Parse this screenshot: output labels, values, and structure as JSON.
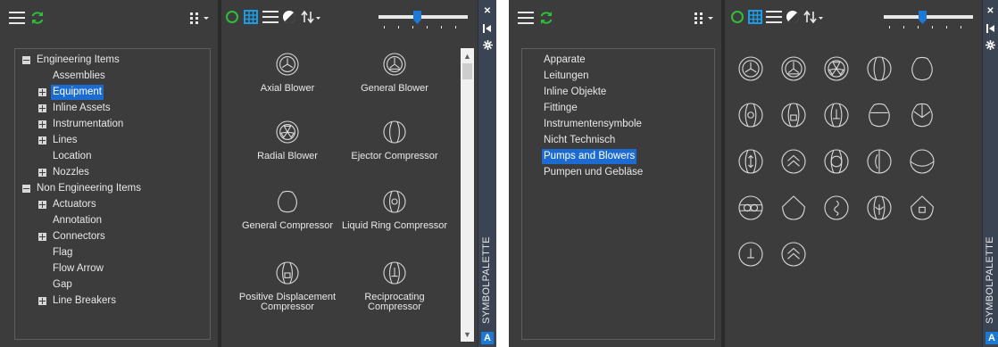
{
  "palette_left": {
    "tree": [
      {
        "label": "Engineering Items",
        "expander": "minus"
      },
      {
        "label": "Assemblies",
        "expander": "none"
      },
      {
        "label": "Equipment",
        "expander": "plus",
        "selected": true
      },
      {
        "label": "Inline Assets",
        "expander": "plus"
      },
      {
        "label": "Instrumentation",
        "expander": "plus"
      },
      {
        "label": "Lines",
        "expander": "plus"
      },
      {
        "label": "Location",
        "expander": "none"
      },
      {
        "label": "Nozzles",
        "expander": "plus"
      },
      {
        "label": "Non Engineering Items",
        "expander": "minus"
      },
      {
        "label": "Actuators",
        "expander": "plus"
      },
      {
        "label": "Annotation",
        "expander": "none"
      },
      {
        "label": "Connectors",
        "expander": "plus"
      },
      {
        "label": "Flag",
        "expander": "none"
      },
      {
        "label": "Flow Arrow",
        "expander": "none"
      },
      {
        "label": "Gap",
        "expander": "none"
      },
      {
        "label": "Line Breakers",
        "expander": "plus"
      }
    ],
    "tiles": [
      {
        "label": "Axial Blower",
        "icon": "axial-blower-icon"
      },
      {
        "label": "General Blower",
        "icon": "general-blower-icon"
      },
      {
        "label": "Radial Blower",
        "icon": "radial-blower-icon"
      },
      {
        "label": "Ejector Compressor",
        "icon": "ejector-compressor-icon"
      },
      {
        "label": "General Compressor",
        "icon": "general-compressor-icon"
      },
      {
        "label": "Liquid Ring Compressor",
        "icon": "liquid-ring-compressor-icon"
      },
      {
        "label": "Positive Displacement Compressor",
        "icon": "positive-displacement-compressor-icon"
      },
      {
        "label": "Reciprocating Compressor",
        "icon": "reciprocating-compressor-icon"
      }
    ],
    "side_title": "SYMBOLPALETTE",
    "logo": "A"
  },
  "palette_right": {
    "list": [
      {
        "label": "Apparate"
      },
      {
        "label": "Leitungen"
      },
      {
        "label": "Inline Objekte"
      },
      {
        "label": "Fittinge"
      },
      {
        "label": "Instrumentensymbole"
      },
      {
        "label": "Nicht Technisch"
      },
      {
        "label": "Pumps and Blowers",
        "selected": true
      },
      {
        "label": "Pumpen und Gebläse"
      }
    ],
    "icons": [
      "axial-blower-icon",
      "general-blower-icon",
      "radial-blower-icon",
      "ejector-compressor-icon",
      "general-compressor-icon",
      "liquid-ring-compressor-icon",
      "positive-displacement-compressor-icon",
      "reciprocating-compressor-icon",
      "rotary-compressor-icon",
      "screw-compressor-icon",
      "turbine-icon",
      "centrifugal-compressor-icon",
      "ring-compressor-icon",
      "diaphragm-pump-icon",
      "half-circle-pump-icon",
      "double-ring-pump-icon",
      "general-pump-icon",
      "screw-pump-icon",
      "gear-pump-icon",
      "rotary-pump-icon",
      "vertical-pump-icon",
      "chevron-pump-icon"
    ],
    "side_title": "SYMBOLPALETTE",
    "logo": "A"
  },
  "toolbar": {
    "menu_icon": "hamburger-menu-icon",
    "refresh_icon": "refresh-icon",
    "view_options_icon": "grid-options-icon",
    "recent_icon": "recent-circle-icon",
    "grid_view_icon": "grid-view-icon",
    "list_view_icon": "list-view-icon",
    "contrast_icon": "contrast-icon",
    "sort_icon": "sort-icon",
    "size_slider": 0.45
  },
  "colors": {
    "panel_bg": "#3c3c3c",
    "frame_bg": "#3b4453",
    "accent_green": "#2fbf3a",
    "accent_blue": "#1c7ad6",
    "selection_blue": "#1c6bd1",
    "symbol_stroke": "#d8d8d8"
  }
}
